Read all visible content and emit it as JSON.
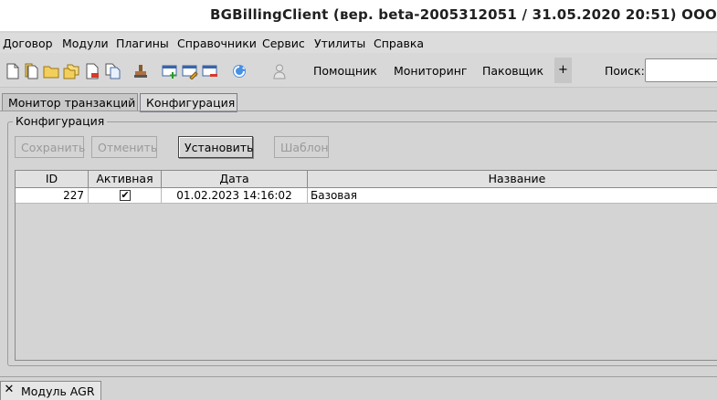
{
  "window": {
    "title": "BGBillingClient (вер. beta-2005312051 / 31.05.2020 20:51) ООО"
  },
  "menu": {
    "items": [
      "Договор",
      "Модули",
      "Плагины",
      "Справочники",
      "Сервис",
      "Утилиты",
      "Справка"
    ]
  },
  "toolbar": {
    "icons": [
      "new-document-icon",
      "copy-document-icon",
      "open-folder-icon",
      "folders-icon",
      "delete-document-icon",
      "documents-icon",
      "stamp-icon",
      "window-add-icon",
      "window-edit-icon",
      "window-remove-icon",
      "refresh-icon",
      "user-icon"
    ],
    "text_buttons": [
      "Помощник",
      "Мониторинг",
      "Паковщик"
    ],
    "plus_label": "+",
    "search_label": "Поиск:",
    "search_value": ""
  },
  "tabs": [
    {
      "label": "Монитор транзакций",
      "active": false
    },
    {
      "label": "Конфигурация",
      "active": true
    }
  ],
  "config": {
    "group_title": "Конфигурация",
    "buttons": {
      "save": "Сохранить",
      "cancel": "Отменить",
      "install": "Установить",
      "template": "Шаблон"
    },
    "table": {
      "columns": [
        "ID",
        "Активная",
        "Дата",
        "Название"
      ],
      "rows": [
        {
          "id": "227",
          "active": true,
          "date": "01.02.2023 14:16:02",
          "name": "Базовая"
        }
      ],
      "check_mark": "✔"
    }
  },
  "bottom": {
    "tab_label": "Модуль AGR",
    "close_glyph": "✕"
  }
}
